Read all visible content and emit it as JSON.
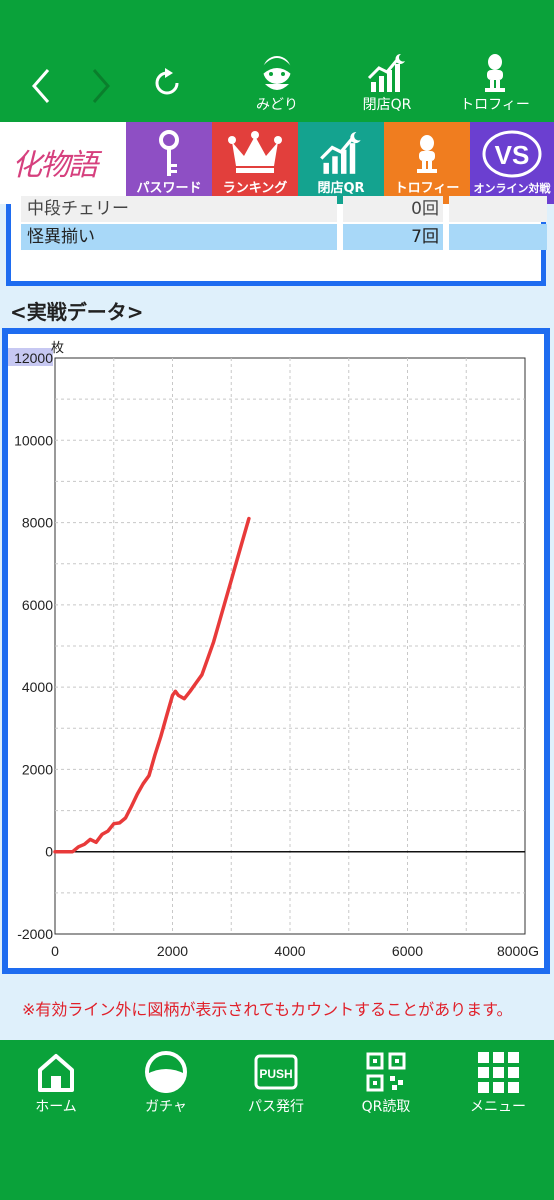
{
  "topnav": {
    "back_icon": "chevron-left-icon",
    "forward_icon": "chevron-right-icon",
    "reload_icon": "reload-icon",
    "items": [
      {
        "label": "みどり",
        "icon": "character-icon"
      },
      {
        "label": "閉店QR",
        "icon": "chart-moon-icon"
      },
      {
        "label": "トロフィー",
        "icon": "trophy-icon"
      }
    ]
  },
  "tiles": {
    "logo_text": "化物語",
    "items": [
      {
        "label": "パスワード",
        "icon": "key-icon",
        "color": "#8e4fc4"
      },
      {
        "label": "ランキング",
        "icon": "crown-icon",
        "color": "#e23f3c"
      },
      {
        "label": "閉店QR",
        "icon": "chart-moon-icon",
        "color": "#14a38f"
      },
      {
        "label": "トロフィー",
        "icon": "trophy-icon",
        "color": "#f07d1f"
      },
      {
        "label": "オンライン対戦",
        "icon": "vs-icon",
        "color": "#6b3fd0"
      }
    ]
  },
  "stats_table": {
    "rows": [
      {
        "name": "中段チェリー",
        "value": "0回",
        "extra": ""
      },
      {
        "name": "怪異揃い",
        "value": "7回",
        "extra": ""
      }
    ]
  },
  "section_title": "<実戦データ>",
  "chart_data": {
    "type": "line",
    "yunit": "枚",
    "ylim": [
      -2000,
      12000
    ],
    "xlim": [
      0,
      8000
    ],
    "yticks": [
      "12000",
      "10000",
      "8000",
      "6000",
      "4000",
      "2000",
      "0",
      "-2000"
    ],
    "xticks": [
      "0",
      "2000",
      "4000",
      "6000",
      "8000G"
    ],
    "grid": true,
    "line_color": "#e83a3a",
    "series": [
      {
        "x": [
          0,
          300,
          400,
          500,
          600,
          700,
          800,
          900,
          1000,
          1100,
          1200,
          1300,
          1400,
          1500,
          1600,
          1700,
          1800,
          1900,
          2000,
          2050,
          2100,
          2200,
          2300,
          2400,
          2500,
          2600,
          2700,
          2800,
          2900,
          3000,
          3100,
          3200,
          3300
        ],
        "y": [
          0,
          0,
          120,
          180,
          300,
          230,
          420,
          500,
          680,
          700,
          820,
          1100,
          1400,
          1650,
          1850,
          2350,
          2800,
          3300,
          3800,
          3900,
          3800,
          3720,
          3900,
          4100,
          4300,
          4700,
          5100,
          5600,
          6100,
          6600,
          7100,
          7600,
          8100
        ]
      }
    ]
  },
  "notice": "※有効ライン外に図柄が表示されてもカウントすることがあります。",
  "bottomnav": {
    "items": [
      {
        "label": "ホーム",
        "icon": "home-icon"
      },
      {
        "label": "ガチャ",
        "icon": "gacha-icon"
      },
      {
        "label": "パス発行",
        "icon": "push-icon"
      },
      {
        "label": "QR読取",
        "icon": "qr-icon"
      },
      {
        "label": "メニュー",
        "icon": "menu-grid-icon"
      }
    ]
  }
}
